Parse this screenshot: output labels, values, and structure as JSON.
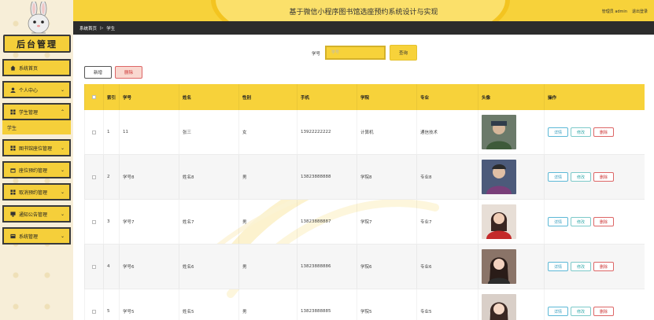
{
  "header": {
    "title": "基于微信小程序图书馆选座预约系统设计与实现",
    "user": "管理员 admin",
    "logout": "退出登录"
  },
  "sidebar": {
    "title": "后台管理",
    "items": [
      {
        "label": "系统首页",
        "icon": "home-icon"
      },
      {
        "label": "个人中心",
        "icon": "person-icon"
      },
      {
        "label": "学生管理",
        "icon": "grid-icon"
      },
      {
        "label": "图书馆座位管理",
        "icon": "grid-icon"
      },
      {
        "label": "座位预约管理",
        "icon": "calendar-icon"
      },
      {
        "label": "取消预约管理",
        "icon": "grid-icon"
      },
      {
        "label": "通知公告管理",
        "icon": "monitor-icon"
      },
      {
        "label": "系统管理",
        "icon": "gear-icon"
      }
    ],
    "submenu": "学生"
  },
  "breadcrumb": {
    "home": "系统首页",
    "sep": "▷",
    "current": "学生"
  },
  "search": {
    "label": "学号",
    "placeholder": "学号",
    "button": "查询"
  },
  "actions": {
    "add": "新增",
    "delete": "删除"
  },
  "table": {
    "headers": [
      "",
      "索引",
      "学号",
      "姓名",
      "性别",
      "手机",
      "学院",
      "专业",
      "头像",
      "操作"
    ],
    "ops": {
      "detail": "详情",
      "edit": "修改",
      "delete": "删除"
    },
    "rows": [
      {
        "idx": "1",
        "id": "11",
        "name": "张三",
        "gender": "女",
        "phone": "13922222222",
        "college": "计算机",
        "major": "通信技术"
      },
      {
        "idx": "2",
        "id": "学号8",
        "name": "姓名8",
        "gender": "男",
        "phone": "13823888888",
        "college": "学院8",
        "major": "专业8"
      },
      {
        "idx": "3",
        "id": "学号7",
        "name": "姓名7",
        "gender": "男",
        "phone": "13823888887",
        "college": "学院7",
        "major": "专业7"
      },
      {
        "idx": "4",
        "id": "学号6",
        "name": "姓名6",
        "gender": "男",
        "phone": "13823888886",
        "college": "学院6",
        "major": "专业6"
      },
      {
        "idx": "5",
        "id": "学号5",
        "name": "姓名5",
        "gender": "男",
        "phone": "13823888885",
        "college": "学院5",
        "major": "专业5"
      }
    ]
  },
  "colors": {
    "accent": "#f7d23a",
    "dark": "#2c2c2c",
    "danger": "#cc3333"
  }
}
